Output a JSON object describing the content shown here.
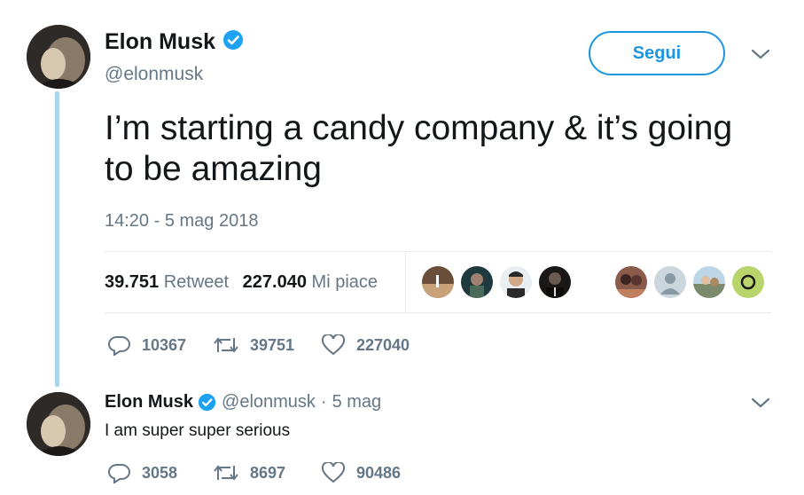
{
  "colors": {
    "accent": "#1b95e0",
    "thread_line": "#a9d5ee",
    "muted": "#657786"
  },
  "main_tweet": {
    "author_name": "Elon Musk",
    "author_handle": "@elonmusk",
    "verified": true,
    "follow_label": "Segui",
    "text": "I’m starting a candy company & it’s going to be amazing",
    "timestamp": "14:20 - 5 mag 2018",
    "retweet_count": "39.751",
    "retweet_label": "Retweet",
    "like_count": "227.040",
    "like_label": "Mi piace",
    "actions": {
      "replies": "10367",
      "retweets": "39751",
      "likes": "227040"
    }
  },
  "reply_tweet": {
    "author_name": "Elon Musk",
    "author_handle": "@elonmusk",
    "separator": "·",
    "date": "5 mag",
    "text": "I am super super serious",
    "actions": {
      "replies": "3058",
      "retweets": "8697",
      "likes": "90486"
    }
  }
}
